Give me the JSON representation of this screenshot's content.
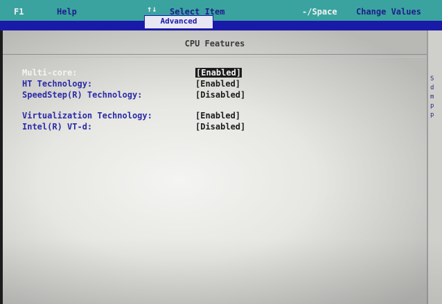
{
  "helpbar": {
    "f1_key": "F1",
    "f1_label": "Help",
    "arrows_key": "↑↓",
    "arrows_label": "Select Item",
    "space_key": "-/Space",
    "space_label": "Change Values"
  },
  "tabs": {
    "active": "Advanced"
  },
  "section": {
    "title": "CPU Features"
  },
  "settings": [
    {
      "label": "Multi-core:",
      "value": "[Enabled]"
    },
    {
      "label": "HT Technology:",
      "value": "[Enabled]"
    },
    {
      "label": "SpeedStep(R) Technology:",
      "value": "[Disabled]"
    },
    {
      "label": "Virtualization Technology:",
      "value": "[Enabled]"
    },
    {
      "label": "Intel(R) VT-d:",
      "value": "[Disabled]"
    }
  ],
  "side_panel": {
    "letters": "S\nd\nm\np\np"
  },
  "colors": {
    "helpbar": "#3aa3a0",
    "tabbar": "#1a1aa8",
    "label_blue": "#2a2aa8"
  }
}
